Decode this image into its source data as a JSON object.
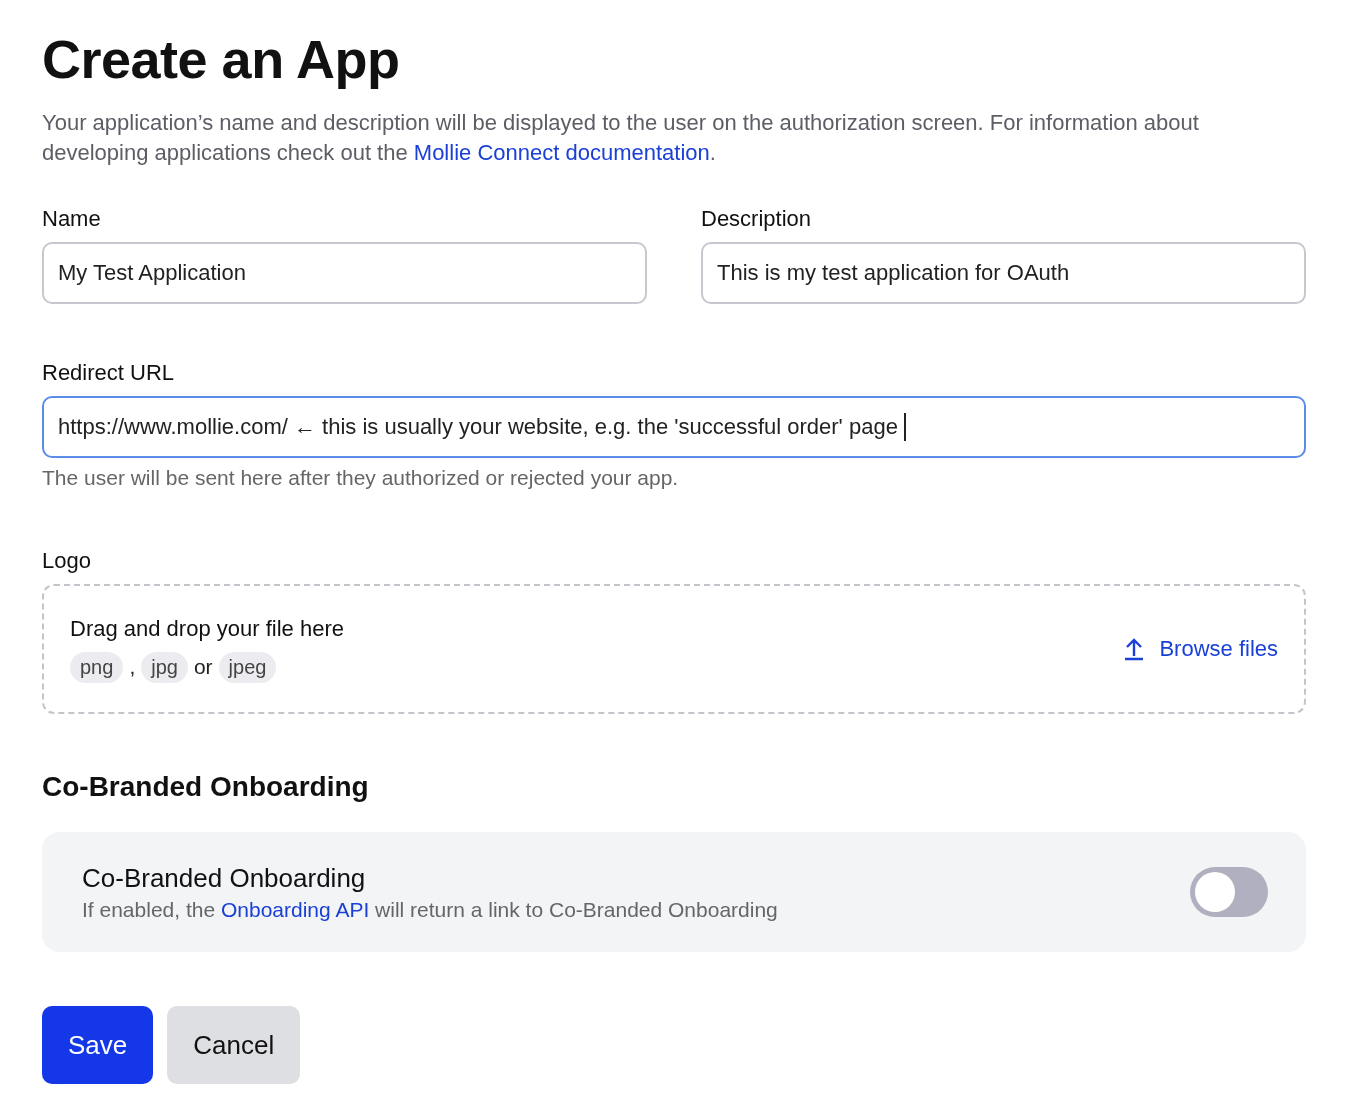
{
  "title": "Create an App",
  "intro": {
    "before": "Your application’s name and description will be displayed to the user on the authorization screen. For information about developing applications check out the ",
    "link": "Mollie Connect documentation",
    "after": "."
  },
  "fields": [
    {
      "label": "Name",
      "value": "My Test Application",
      "focused": false
    },
    {
      "label": "Description",
      "value": "This is my test application for OAuth",
      "focused": false
    }
  ],
  "redirect": {
    "label": "Redirect URL",
    "value": "https://www.mollie.com/ ← this is usually your website, e.g. the 'successful order' page",
    "focused": true,
    "help": "The user will be sent here after they authorized or rejected your app."
  },
  "logo": {
    "label": "Logo",
    "drop_text": "Drag and drop your file here",
    "formats": [
      {
        "kind": "chip",
        "text": "png"
      },
      {
        "kind": "sep",
        "text": ","
      },
      {
        "kind": "chip",
        "text": "jpg"
      },
      {
        "kind": "sep",
        "text": "or"
      },
      {
        "kind": "chip",
        "text": "jpeg"
      }
    ],
    "browse": "Browse files"
  },
  "section_title": "Co-Branded Onboarding",
  "toggle_card": {
    "title": "Co-Branded Onboarding",
    "before": "If enabled, the ",
    "link": "Onboarding API",
    "after": " will return a link to Co-Branded Onboarding",
    "on": false
  },
  "buttons": [
    {
      "label": "Save",
      "kind": "primary"
    },
    {
      "label": "Cancel",
      "kind": "secondary"
    }
  ]
}
